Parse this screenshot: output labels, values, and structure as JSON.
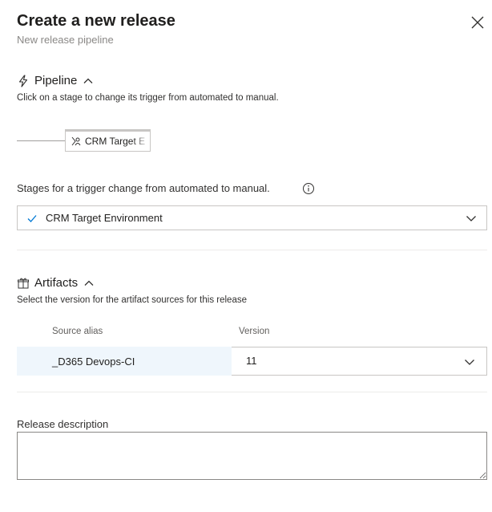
{
  "dialog": {
    "title": "Create a new release",
    "subtitle": "New release pipeline"
  },
  "pipeline": {
    "heading": "Pipeline",
    "description": "Click on a stage to change its trigger from automated to manual.",
    "stage_label": "CRM Target E"
  },
  "trigger": {
    "label": "Stages for a trigger change from automated to manual.",
    "selected": "CRM Target Environment"
  },
  "artifacts": {
    "heading": "Artifacts",
    "description": "Select the version for the artifact sources for this release",
    "columns": [
      "Source alias",
      "Version"
    ],
    "rows": [
      {
        "alias": "_D365 Devops-CI",
        "version": "11"
      }
    ]
  },
  "release_description": {
    "label": "Release description",
    "value": ""
  },
  "colors": {
    "row_highlight": "#eff6fc",
    "accent": "#0078d4"
  },
  "icons": [
    "close-icon",
    "lightning-icon",
    "chevron-up-icon",
    "stage-person-icon",
    "info-icon",
    "checkmark-icon",
    "chevron-down-icon",
    "gift-icon"
  ]
}
